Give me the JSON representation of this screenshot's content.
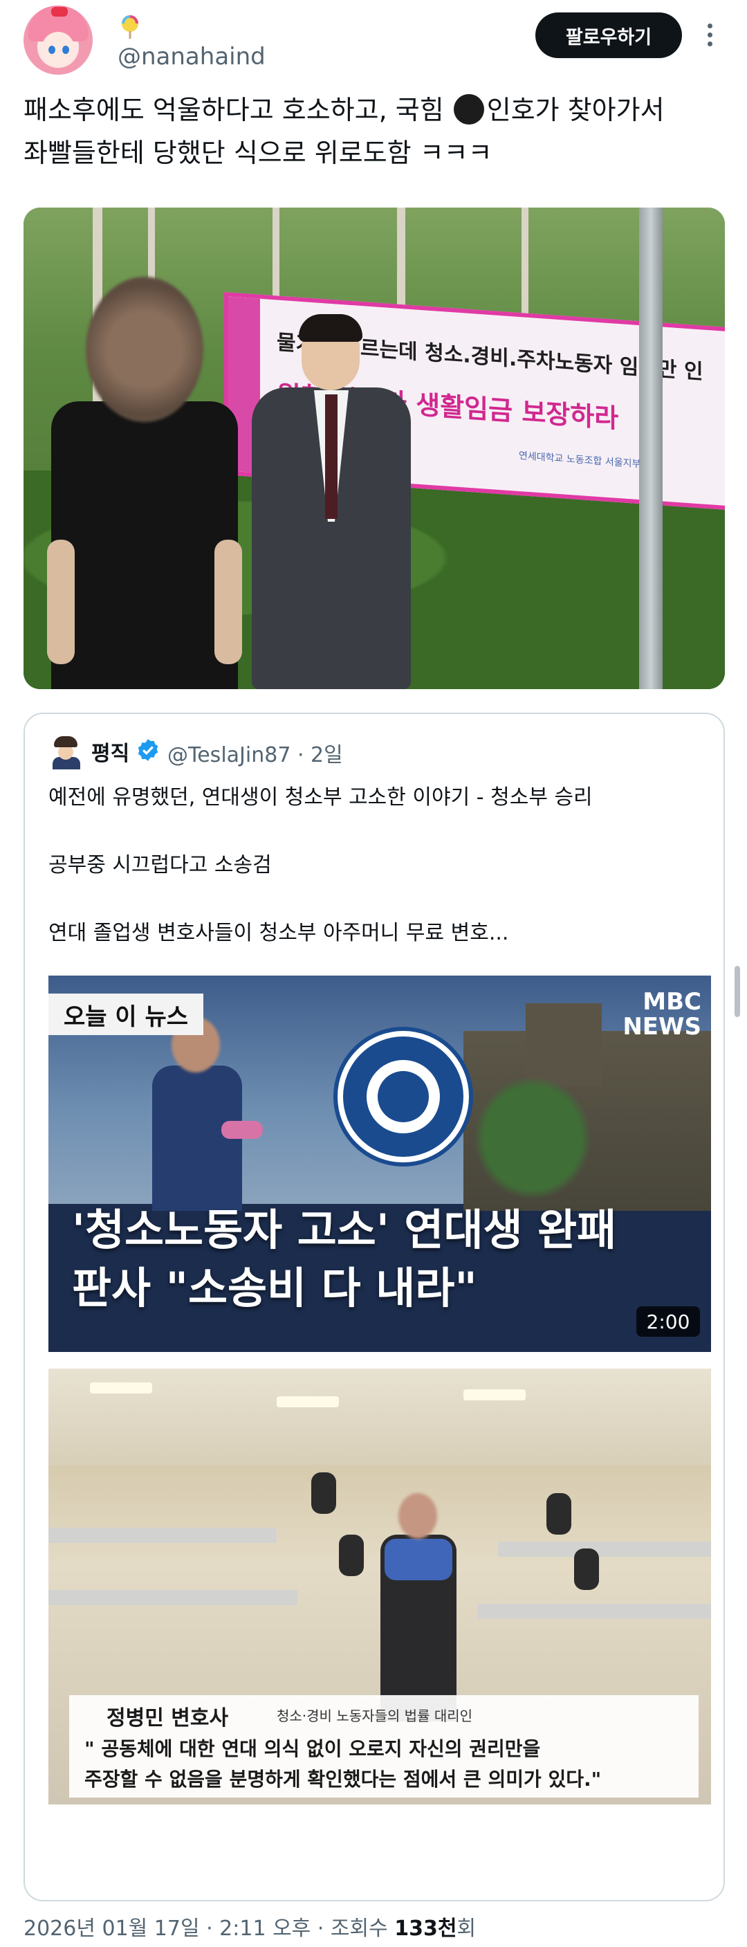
{
  "header": {
    "emoji_icon": "lollipop-icon",
    "handle": "@nanahaind",
    "follow_label": "팔로우하기"
  },
  "tweet": {
    "text_before_censor": "패소후에도 억울하다고 호소하고, 국힘 ",
    "text_after_censor": "인호가 찾아가서",
    "text_line2": "좌빨들한테 당했단 식으로 위로도함 ㅋㅋㅋ"
  },
  "photo": {
    "banner_line1": "물가는 오르는데 청소.경비.주차노동자 임금만 인",
    "banner_line2": "원청 학교가 생활임금 보장하라",
    "banner_line3": "연세대학교 노동조합 서울지부"
  },
  "quote": {
    "name": "평직",
    "handle_time": "@TeslaJin87 · 2일",
    "lines": [
      "예전에 유명했던, 연대생이 청소부 고소한 이야기 - 청소부 승리",
      "공부중 시끄럽다고 소송검",
      "연대 졸업생 변호사들이 청소부 아주머니 무료 변호..."
    ],
    "news1": {
      "tag": "오늘 이 뉴스",
      "logo_line1": "MBC",
      "logo_line2": "NEWS",
      "headline_line1": "'청소노동자 고소' 연대생 완패",
      "headline_line2": "판사 \"소송비 다 내라\"",
      "duration": "2:00"
    },
    "news2": {
      "caption_name": "정병민 변호사",
      "caption_role": "청소·경비 노동자들의 법률 대리인",
      "caption_line1": "\" 공동체에 대한 연대 의식 없이 오로지 자신의 권리만을",
      "caption_line2": "주장할 수 없음을 분명하게 확인했다는 점에서 큰 의미가 있다.\""
    }
  },
  "meta": {
    "date_time": "2026년 01월 17일 · 2:11 오후 · 조회수 ",
    "views": "133천",
    "views_suffix": "회"
  },
  "colors": {
    "text": "#0f1419",
    "secondary": "#536471",
    "verified": "#1d9bf0",
    "border": "#cfd9de",
    "follow_button": "#0f1419"
  }
}
